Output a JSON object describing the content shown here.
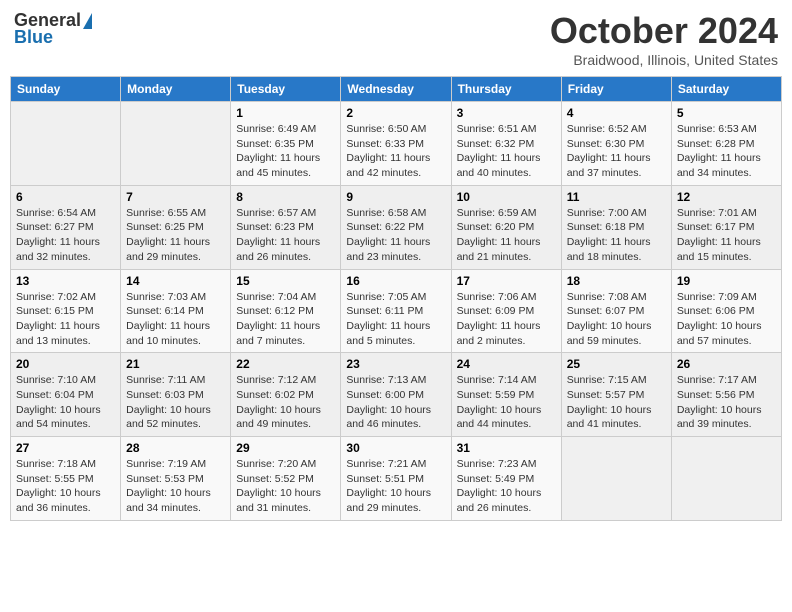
{
  "header": {
    "logo_general": "General",
    "logo_blue": "Blue",
    "month_title": "October 2024",
    "location": "Braidwood, Illinois, United States"
  },
  "days_of_week": [
    "Sunday",
    "Monday",
    "Tuesday",
    "Wednesday",
    "Thursday",
    "Friday",
    "Saturday"
  ],
  "weeks": [
    [
      {
        "day": "",
        "info": ""
      },
      {
        "day": "",
        "info": ""
      },
      {
        "day": "1",
        "info": "Sunrise: 6:49 AM\nSunset: 6:35 PM\nDaylight: 11 hours and 45 minutes."
      },
      {
        "day": "2",
        "info": "Sunrise: 6:50 AM\nSunset: 6:33 PM\nDaylight: 11 hours and 42 minutes."
      },
      {
        "day": "3",
        "info": "Sunrise: 6:51 AM\nSunset: 6:32 PM\nDaylight: 11 hours and 40 minutes."
      },
      {
        "day": "4",
        "info": "Sunrise: 6:52 AM\nSunset: 6:30 PM\nDaylight: 11 hours and 37 minutes."
      },
      {
        "day": "5",
        "info": "Sunrise: 6:53 AM\nSunset: 6:28 PM\nDaylight: 11 hours and 34 minutes."
      }
    ],
    [
      {
        "day": "6",
        "info": "Sunrise: 6:54 AM\nSunset: 6:27 PM\nDaylight: 11 hours and 32 minutes."
      },
      {
        "day": "7",
        "info": "Sunrise: 6:55 AM\nSunset: 6:25 PM\nDaylight: 11 hours and 29 minutes."
      },
      {
        "day": "8",
        "info": "Sunrise: 6:57 AM\nSunset: 6:23 PM\nDaylight: 11 hours and 26 minutes."
      },
      {
        "day": "9",
        "info": "Sunrise: 6:58 AM\nSunset: 6:22 PM\nDaylight: 11 hours and 23 minutes."
      },
      {
        "day": "10",
        "info": "Sunrise: 6:59 AM\nSunset: 6:20 PM\nDaylight: 11 hours and 21 minutes."
      },
      {
        "day": "11",
        "info": "Sunrise: 7:00 AM\nSunset: 6:18 PM\nDaylight: 11 hours and 18 minutes."
      },
      {
        "day": "12",
        "info": "Sunrise: 7:01 AM\nSunset: 6:17 PM\nDaylight: 11 hours and 15 minutes."
      }
    ],
    [
      {
        "day": "13",
        "info": "Sunrise: 7:02 AM\nSunset: 6:15 PM\nDaylight: 11 hours and 13 minutes."
      },
      {
        "day": "14",
        "info": "Sunrise: 7:03 AM\nSunset: 6:14 PM\nDaylight: 11 hours and 10 minutes."
      },
      {
        "day": "15",
        "info": "Sunrise: 7:04 AM\nSunset: 6:12 PM\nDaylight: 11 hours and 7 minutes."
      },
      {
        "day": "16",
        "info": "Sunrise: 7:05 AM\nSunset: 6:11 PM\nDaylight: 11 hours and 5 minutes."
      },
      {
        "day": "17",
        "info": "Sunrise: 7:06 AM\nSunset: 6:09 PM\nDaylight: 11 hours and 2 minutes."
      },
      {
        "day": "18",
        "info": "Sunrise: 7:08 AM\nSunset: 6:07 PM\nDaylight: 10 hours and 59 minutes."
      },
      {
        "day": "19",
        "info": "Sunrise: 7:09 AM\nSunset: 6:06 PM\nDaylight: 10 hours and 57 minutes."
      }
    ],
    [
      {
        "day": "20",
        "info": "Sunrise: 7:10 AM\nSunset: 6:04 PM\nDaylight: 10 hours and 54 minutes."
      },
      {
        "day": "21",
        "info": "Sunrise: 7:11 AM\nSunset: 6:03 PM\nDaylight: 10 hours and 52 minutes."
      },
      {
        "day": "22",
        "info": "Sunrise: 7:12 AM\nSunset: 6:02 PM\nDaylight: 10 hours and 49 minutes."
      },
      {
        "day": "23",
        "info": "Sunrise: 7:13 AM\nSunset: 6:00 PM\nDaylight: 10 hours and 46 minutes."
      },
      {
        "day": "24",
        "info": "Sunrise: 7:14 AM\nSunset: 5:59 PM\nDaylight: 10 hours and 44 minutes."
      },
      {
        "day": "25",
        "info": "Sunrise: 7:15 AM\nSunset: 5:57 PM\nDaylight: 10 hours and 41 minutes."
      },
      {
        "day": "26",
        "info": "Sunrise: 7:17 AM\nSunset: 5:56 PM\nDaylight: 10 hours and 39 minutes."
      }
    ],
    [
      {
        "day": "27",
        "info": "Sunrise: 7:18 AM\nSunset: 5:55 PM\nDaylight: 10 hours and 36 minutes."
      },
      {
        "day": "28",
        "info": "Sunrise: 7:19 AM\nSunset: 5:53 PM\nDaylight: 10 hours and 34 minutes."
      },
      {
        "day": "29",
        "info": "Sunrise: 7:20 AM\nSunset: 5:52 PM\nDaylight: 10 hours and 31 minutes."
      },
      {
        "day": "30",
        "info": "Sunrise: 7:21 AM\nSunset: 5:51 PM\nDaylight: 10 hours and 29 minutes."
      },
      {
        "day": "31",
        "info": "Sunrise: 7:23 AM\nSunset: 5:49 PM\nDaylight: 10 hours and 26 minutes."
      },
      {
        "day": "",
        "info": ""
      },
      {
        "day": "",
        "info": ""
      }
    ]
  ]
}
